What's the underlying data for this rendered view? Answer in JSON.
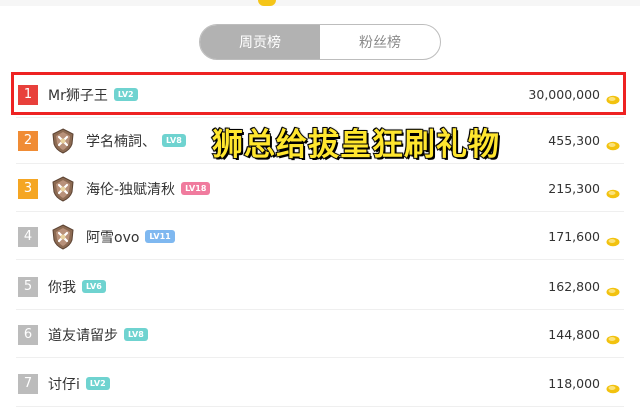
{
  "tabs": {
    "weekly": "周贡榜",
    "fans": "粉丝榜"
  },
  "colors": {
    "rank1": "#e8403b",
    "rank2": "#f08c35",
    "rank3": "#f5a623",
    "rankOther": "#bcbcbc",
    "lvTeal": "#6fd3d0",
    "lvBlue": "#7fb8f0",
    "lvPink": "#f07b9e",
    "highlight": "#ee2222",
    "caption": "#ffe62e"
  },
  "caption": "狮总给拔皇狂刷礼物",
  "ranking": [
    {
      "rank": "1",
      "name": "Mr狮子王",
      "level": "LV2",
      "level_color": "teal",
      "score": "30,000,000",
      "badge": false
    },
    {
      "rank": "2",
      "name": "学名楠詞、",
      "level": "LV8",
      "level_color": "teal",
      "score": "455,300",
      "badge": true
    },
    {
      "rank": "3",
      "name": "海伦-独赋清秋",
      "level": "LV18",
      "level_color": "pink",
      "score": "215,300",
      "badge": true
    },
    {
      "rank": "4",
      "name": "阿雪ovo",
      "level": "LV11",
      "level_color": "blue",
      "score": "171,600",
      "badge": true
    },
    {
      "rank": "5",
      "name": "你我",
      "level": "LV6",
      "level_color": "teal",
      "score": "162,800",
      "badge": false
    },
    {
      "rank": "6",
      "name": "道友请留步",
      "level": "LV8",
      "level_color": "teal",
      "score": "144,800",
      "badge": false
    },
    {
      "rank": "7",
      "name": "讨仔i",
      "level": "LV2",
      "level_color": "teal",
      "score": "118,000",
      "badge": false
    }
  ],
  "icons": {
    "badge": "sword-shield-icon",
    "coin": "gold-coin-icon"
  }
}
